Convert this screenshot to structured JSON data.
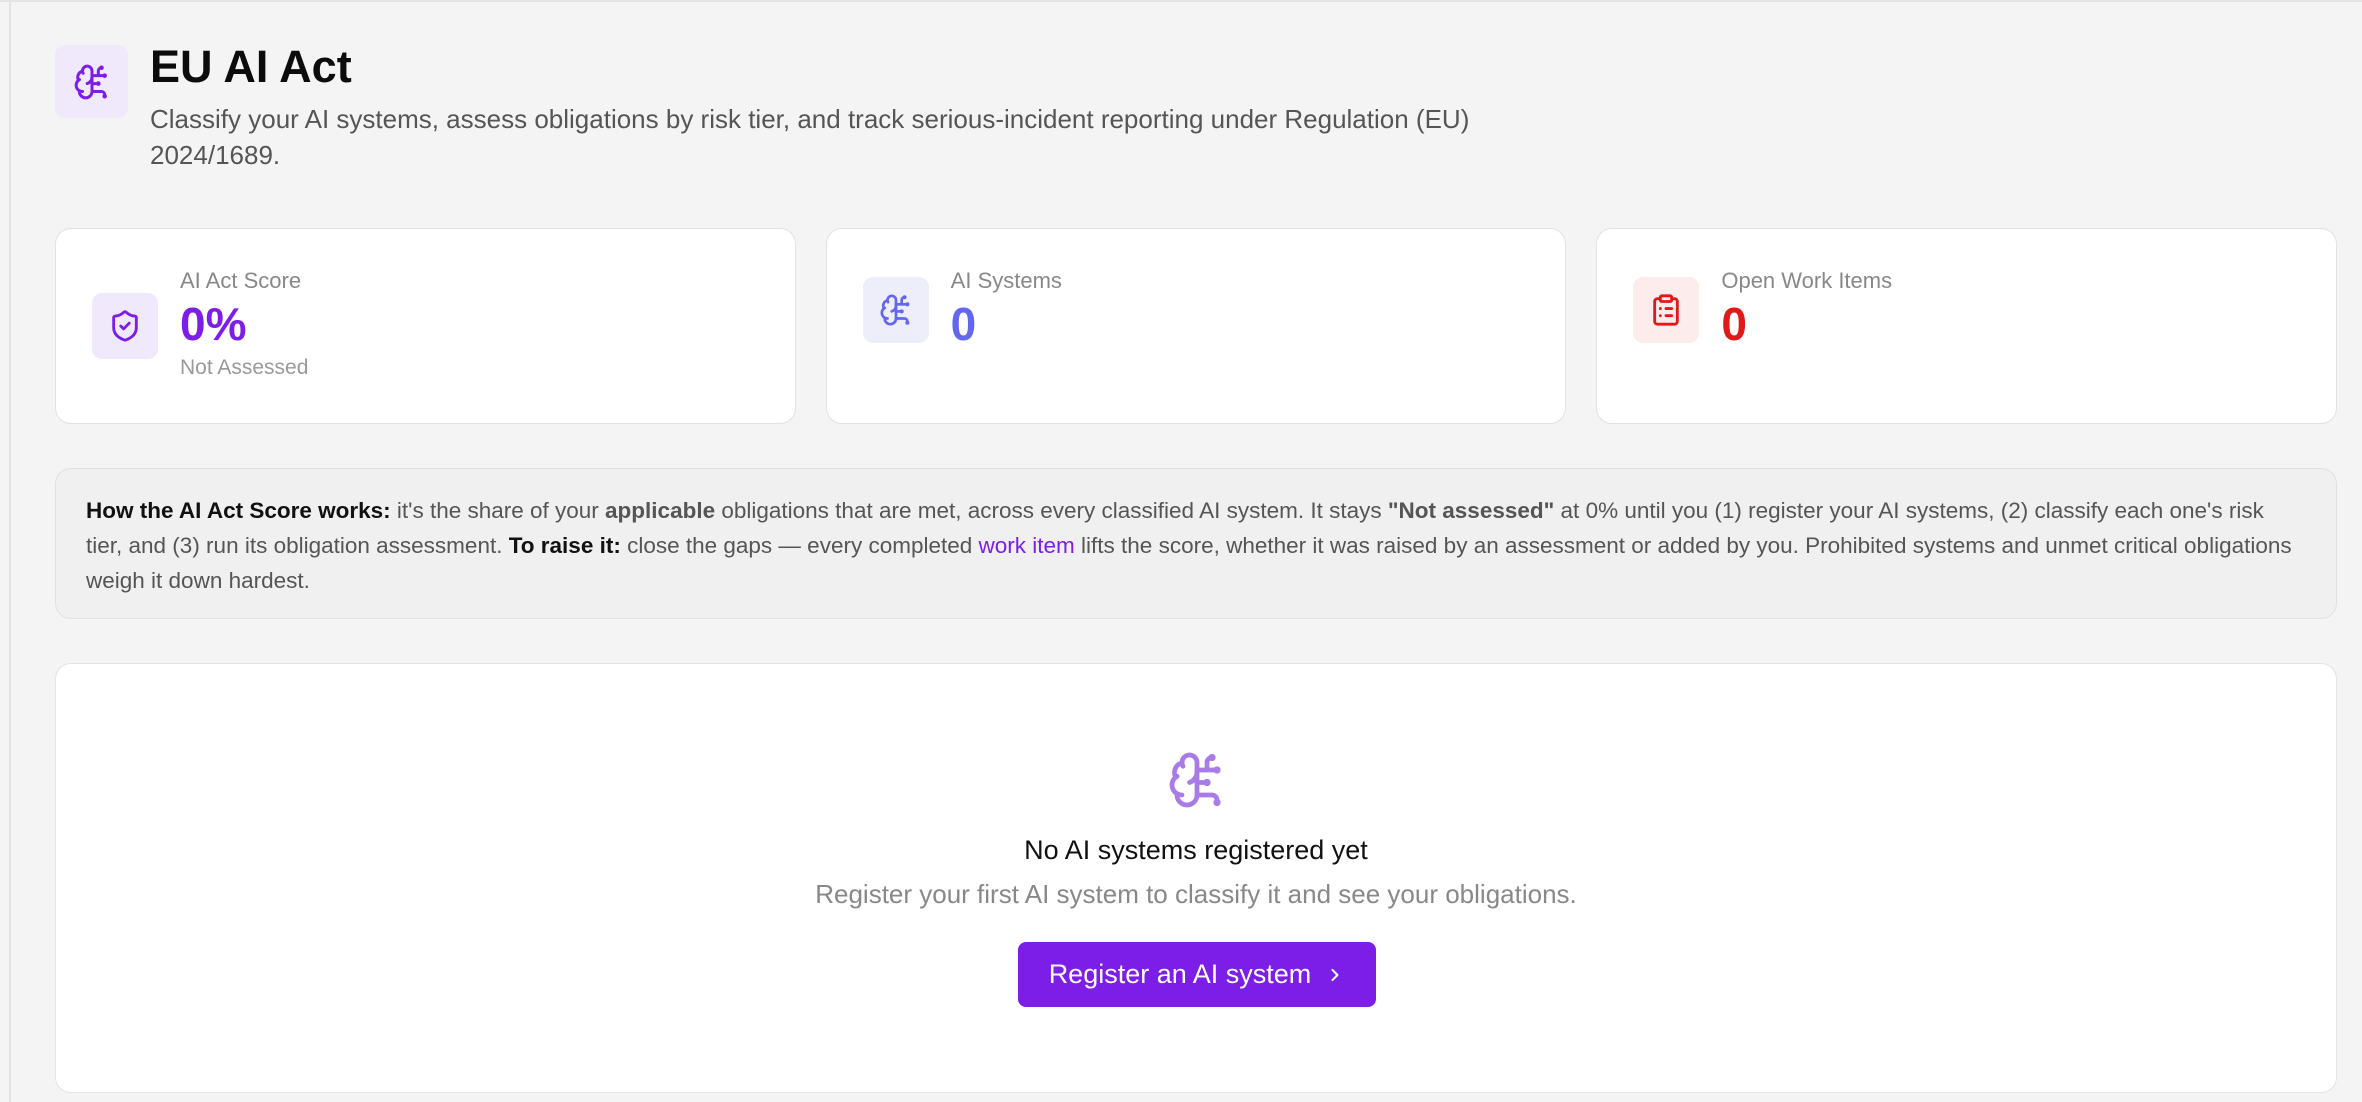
{
  "header": {
    "title": "EU AI Act",
    "subtitle": "Classify your AI systems, assess obligations by risk tier, and track serious-incident reporting under Regulation (EU) 2024/1689.",
    "icon": "brain-icon"
  },
  "cards": [
    {
      "label": "AI Act Score",
      "value": "0%",
      "sub": "Not Assessed",
      "icon": "shield-check-icon",
      "color": "#7c1de8",
      "icon_bg": "#efe9fb"
    },
    {
      "label": "AI Systems",
      "value": "0",
      "icon": "brain-icon",
      "color": "#6366f1",
      "icon_bg": "#eeeefb"
    },
    {
      "label": "Open Work Items",
      "value": "0",
      "icon": "clipboard-list-icon",
      "color": "#e01919",
      "icon_bg": "#fcecec"
    }
  ],
  "info": {
    "how_label": "How the AI Act Score works:",
    "t1": " it's the share of your ",
    "applicable": "applicable",
    "t2": " obligations that are met, across every classified AI system. It stays ",
    "not_assessed": "\"Not assessed\"",
    "t3": " at 0% until you (1) register your AI systems, (2) classify each one's risk tier, and (3) run its obligation assessment. ",
    "raise_label": "To raise it:",
    "t4": " close the gaps — every completed ",
    "work_item_link": "work item",
    "t5": " lifts the score, whether it was raised by an assessment or added by you. Prohibited systems and unmet critical obligations weigh it down hardest."
  },
  "empty_state": {
    "title": "No AI systems registered yet",
    "description": "Register your first AI system to classify it and see your obligations.",
    "button_label": "Register an AI system",
    "icon": "brain-icon"
  },
  "colors": {
    "accent": "#7c1de8",
    "indigo": "#6366f1",
    "danger": "#e01919"
  }
}
